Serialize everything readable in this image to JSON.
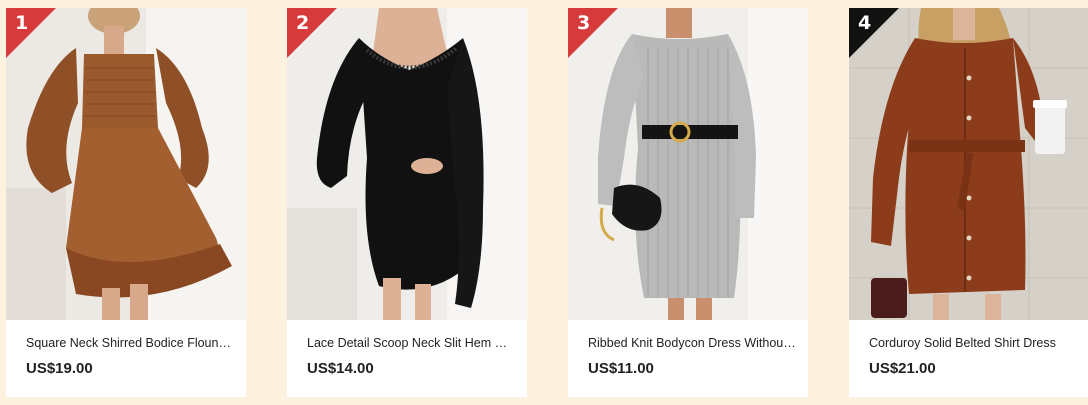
{
  "colors": {
    "page_background": "#fdf2e0",
    "rank_top3": "#d63a3a",
    "rank_other": "#111111"
  },
  "products": [
    {
      "rank": "1",
      "title": "Square Neck Shirred Bodice Flounce Sleeve Ruffle Hem Dress",
      "price": "US$19.00",
      "image_desc": "brown-ruffle-dress-photo"
    },
    {
      "rank": "2",
      "title": "Lace Detail Scoop Neck Slit Hem Bodycon Dress",
      "price": "US$14.00",
      "image_desc": "black-lace-bodycon-dress-photo"
    },
    {
      "rank": "3",
      "title": "Ribbed Knit Bodycon Dress Without Belt",
      "price": "US$11.00",
      "image_desc": "grey-ribbed-knit-dress-photo"
    },
    {
      "rank": "4",
      "title": "Corduroy Solid Belted Shirt Dress",
      "price": "US$21.00",
      "image_desc": "rust-corduroy-shirt-dress-photo"
    }
  ]
}
